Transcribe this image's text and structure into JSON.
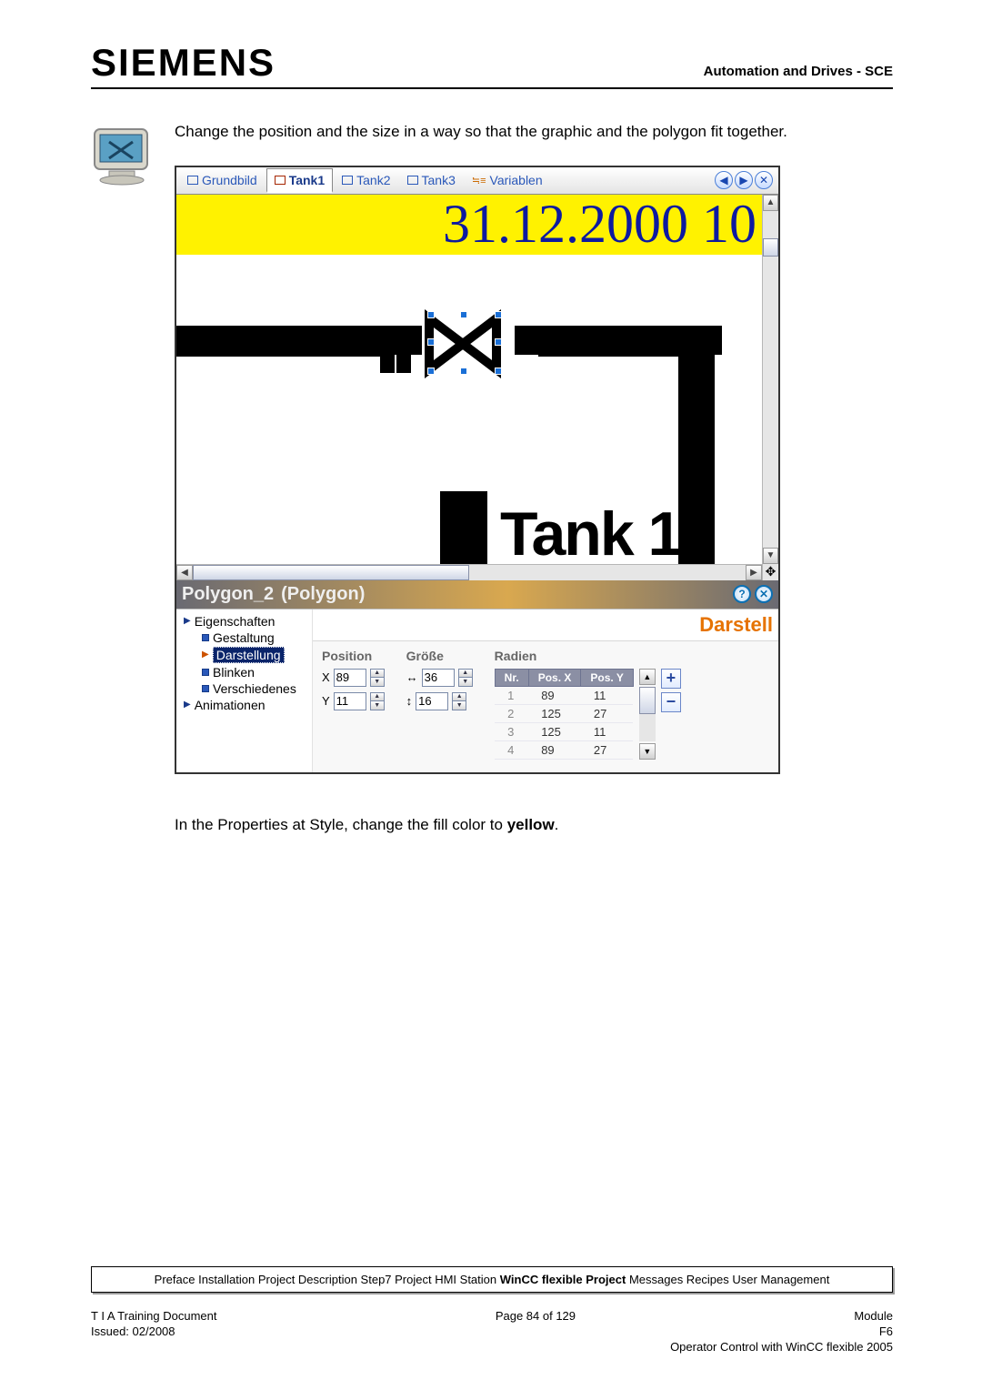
{
  "header": {
    "logo": "SIEMENS",
    "right": "Automation and Drives - SCE"
  },
  "instruction_top": "Change the position and the size in a way so that the graphic and the polygon fit together.",
  "tabs": {
    "items": [
      {
        "label": "Grundbild",
        "active": false
      },
      {
        "label": "Tank1",
        "active": true
      },
      {
        "label": "Tank2",
        "active": false
      },
      {
        "label": "Tank3",
        "active": false
      },
      {
        "label": "Variablen",
        "active": false,
        "alt_icon": true
      }
    ]
  },
  "canvas": {
    "date_text": "31.12.2000 10",
    "tank_label": "Tank 1"
  },
  "props": {
    "title_l": "Polygon_2",
    "title_type": "(Polygon)",
    "heading": "Darstell",
    "tree": {
      "root1": "Eigenschaften",
      "items": [
        "Gestaltung",
        "Darstellung",
        "Blinken",
        "Verschiedenes"
      ],
      "selected_index": 1,
      "root2": "Animationen"
    },
    "fields": {
      "position_label": "Position",
      "size_label": "Größe",
      "radii_label": "Radien",
      "x_label": "X",
      "y_label": "Y",
      "x": "89",
      "y": "11",
      "w": "36",
      "h": "16",
      "radii_headers": [
        "Nr.",
        "Pos. X",
        "Pos. Y"
      ],
      "radii": [
        {
          "n": "1",
          "x": "89",
          "y": "11"
        },
        {
          "n": "2",
          "x": "125",
          "y": "27"
        },
        {
          "n": "3",
          "x": "125",
          "y": "11"
        },
        {
          "n": "4",
          "x": "89",
          "y": "27"
        }
      ]
    }
  },
  "instruction_bottom_pre": "In the Properties at Style, change the fill color to ",
  "instruction_bottom_bold": "yellow",
  "instruction_bottom_post": ".",
  "footer": {
    "nav": {
      "pre": "Preface Installation Project Description Step7 Project HMI Station ",
      "bold": "WinCC flexible Project",
      "post": " Messages Recipes User Management"
    },
    "row1_l": "T I A  Training Document",
    "row1_c": "Page 84 of 129",
    "row1_r": "Module",
    "row2_l": "Issued: 02/2008",
    "row2_r1": "F6",
    "row2_r2": "Operator Control with WinCC flexible 2005"
  }
}
